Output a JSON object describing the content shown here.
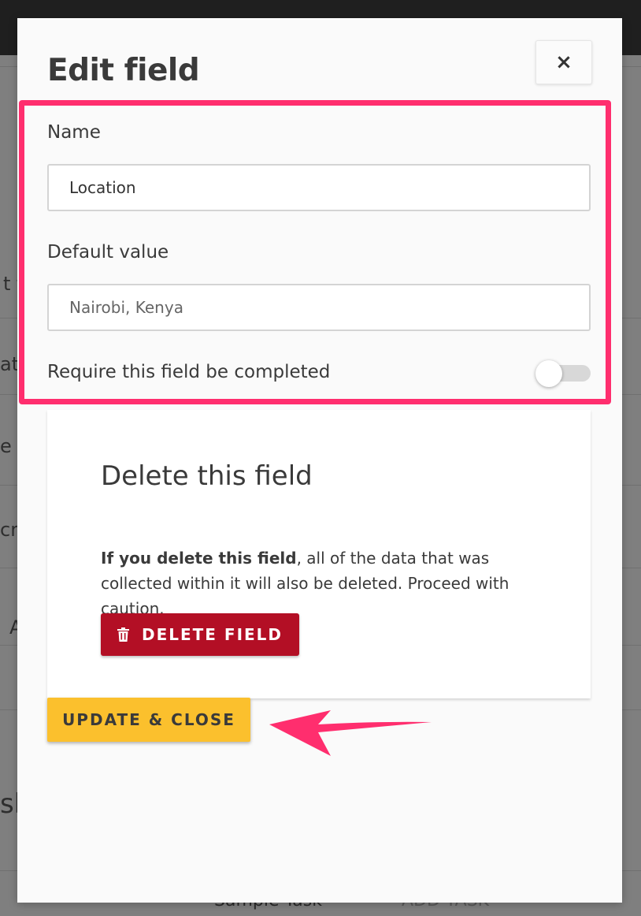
{
  "background": {
    "fragments": [
      "t f",
      "ati",
      "e",
      "cri",
      "A",
      "sk"
    ],
    "bottom_row": {
      "task_name": "Sample Task",
      "bullet": "•",
      "add_task": "ADD TASK"
    }
  },
  "modal": {
    "title": "Edit field",
    "close_icon": "×",
    "form": {
      "name_label": "Name",
      "name_value": "Location",
      "default_label": "Default value",
      "default_placeholder": "Nairobi, Kenya",
      "require_label": "Require this field be completed",
      "require_enabled": false
    },
    "danger_zone": {
      "title": "Delete this field",
      "warning_bold": "If you delete this field",
      "warning_rest": ", all of the data that was collected within it will also be deleted. Proceed with caution.",
      "delete_label": "DELETE FIELD",
      "delete_icon": "trash-icon"
    },
    "update_label": "UPDATE & CLOSE"
  },
  "annotations": {
    "highlight_color": "#ff2e6e",
    "arrow_color": "#ff2e6e"
  },
  "colors": {
    "delete_button": "#b30f25",
    "update_button": "#fbc02d",
    "modal_background": "#fafafa"
  }
}
